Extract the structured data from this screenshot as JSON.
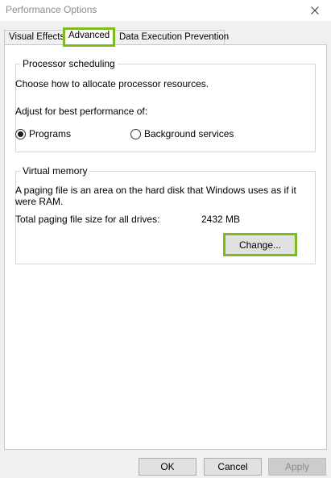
{
  "window": {
    "title": "Performance Options",
    "close_symbol": "close-icon"
  },
  "tabs": [
    {
      "label": "Visual Effects",
      "selected": false
    },
    {
      "label": "Advanced",
      "selected": true
    },
    {
      "label": "Data Execution Prevention",
      "selected": false
    }
  ],
  "processor": {
    "group_title": "Processor scheduling",
    "description": "Choose how to allocate processor resources.",
    "adjust_label": "Adjust for best performance of:",
    "options": [
      {
        "label": "Programs",
        "checked": true
      },
      {
        "label": "Background services",
        "checked": false
      }
    ]
  },
  "virtual_memory": {
    "group_title": "Virtual memory",
    "description": "A paging file is an area on the hard disk that Windows uses as if it were RAM.",
    "total_label": "Total paging file size for all drives:",
    "total_value": "2432 MB",
    "change_label": "Change..."
  },
  "buttons": {
    "ok": "OK",
    "cancel": "Cancel",
    "apply": "Apply"
  },
  "colors": {
    "highlight": "#7dbb1f",
    "title_text": "#8c8c8c"
  }
}
